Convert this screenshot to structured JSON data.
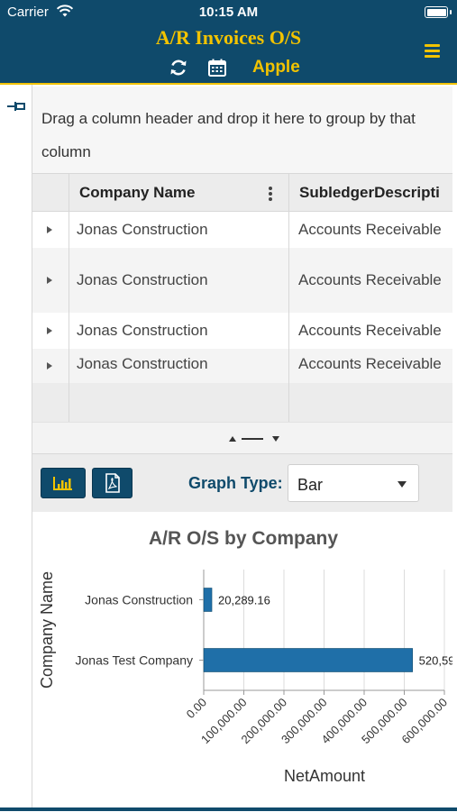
{
  "status": {
    "carrier": "Carrier",
    "time": "10:15 AM"
  },
  "header": {
    "title": "A/R Invoices O/S",
    "company": "Apple"
  },
  "group_bar": {
    "hint": "Drag a column header and drop it here to group by that column"
  },
  "grid": {
    "columns": [
      "Company Name",
      "SubledgerDescripti"
    ],
    "rows": [
      {
        "company": "Jonas Construction",
        "subledger": "Accounts Receivable"
      },
      {
        "company": "Jonas Construction",
        "subledger": "Accounts Receivable"
      },
      {
        "company": "Jonas Construction",
        "subledger": "Accounts Receivable"
      },
      {
        "company": "Jonas Construction",
        "subledger": "Accounts Receivable"
      }
    ]
  },
  "toolbar": {
    "graph_type_label": "Graph Type:",
    "graph_type_value": "Bar"
  },
  "colors": {
    "header_bg": "#0f4a6b",
    "accent": "#f2c300",
    "bar": "#1f6fa8"
  },
  "chart_data": {
    "type": "bar",
    "orientation": "horizontal",
    "title": "A/R O/S by Company",
    "xlabel": "NetAmount",
    "ylabel": "Company Name",
    "categories": [
      "Jonas Construction",
      "Jonas Test Company"
    ],
    "values": [
      20289.16,
      520590
    ],
    "value_labels": [
      "20,289.16",
      "520,59"
    ],
    "xlim": [
      0,
      600000
    ],
    "xticks": [
      "0.00",
      "100,000.00",
      "200,000.00",
      "300,000.00",
      "400,000.00",
      "500,000.00",
      "600,000.00"
    ],
    "grid": true,
    "legend": "none"
  }
}
